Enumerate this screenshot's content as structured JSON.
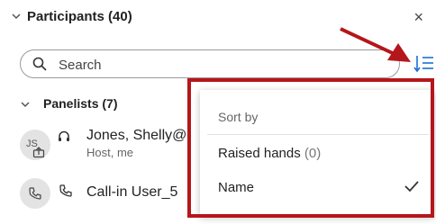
{
  "header": {
    "title": "Participants (40)",
    "close_label": "×"
  },
  "search": {
    "placeholder": "Search",
    "value": ""
  },
  "panelists": {
    "title": "Panelists (7)"
  },
  "participants": [
    {
      "initials": "JS",
      "name": "Jones, Shelly@",
      "role": "Host, me"
    },
    {
      "name": "Call-in User_5"
    }
  ],
  "sort_menu": {
    "header": "Sort by",
    "items": [
      {
        "label": "Raised hands",
        "count": "(0)"
      },
      {
        "label": "Name",
        "selected": true
      }
    ]
  },
  "colors": {
    "accent": "#1a6fd6",
    "annotation": "#b5161b"
  },
  "icons": [
    "chevron-down-icon",
    "close-icon",
    "search-icon",
    "sort-icon",
    "headset-icon",
    "phone-icon",
    "share-icon",
    "checkmark-icon"
  ]
}
